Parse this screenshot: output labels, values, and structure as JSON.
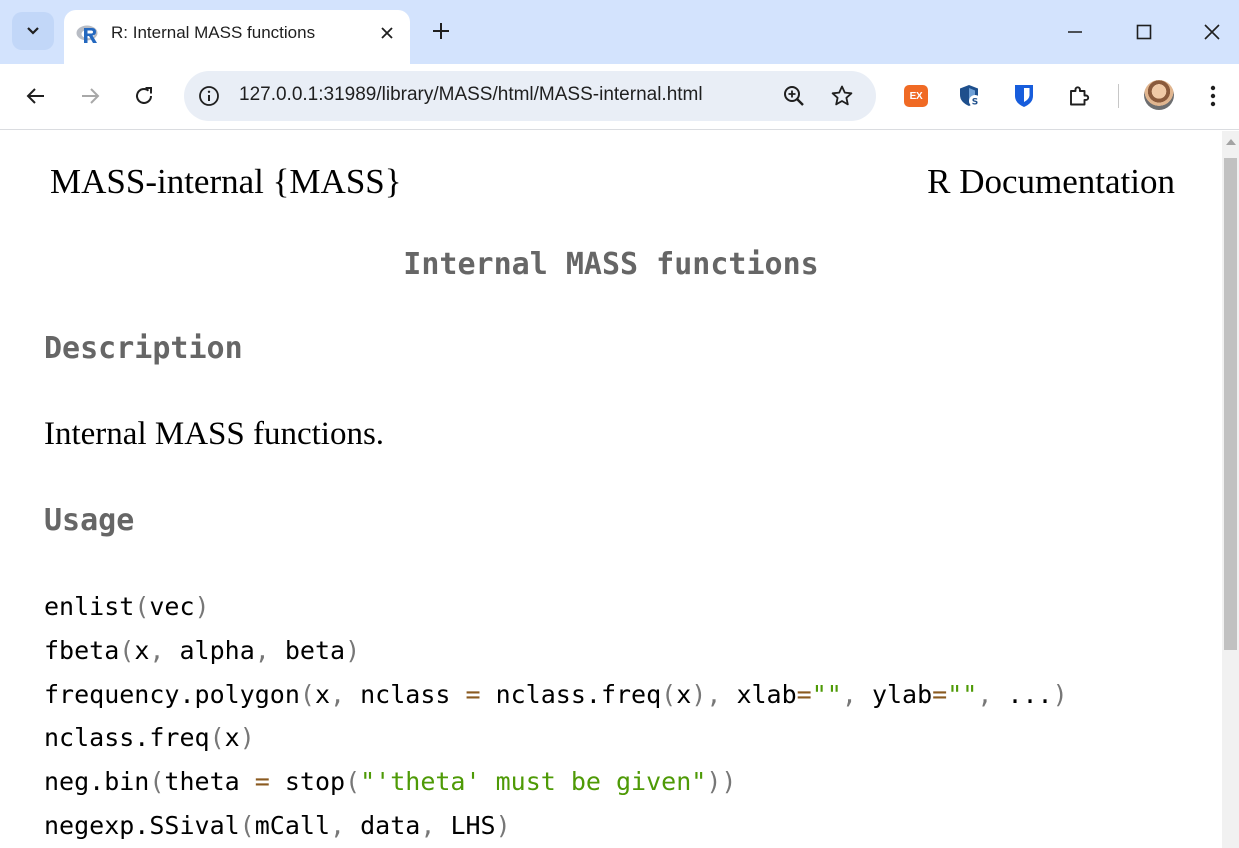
{
  "browser": {
    "tab": {
      "title": "R: Internal MASS functions",
      "favicon": "r-logo-icon"
    },
    "address_bar": {
      "url": "127.0.0.1:31989/library/MASS/html/MASS-internal.html"
    },
    "icons": {
      "tab_list": "chevron-down-icon",
      "tab_close": "close-icon",
      "new_tab": "plus-icon",
      "minimize": "minimize-icon",
      "maximize": "maximize-icon",
      "close_window": "close-icon",
      "back": "arrow-left-icon",
      "forward": "arrow-right-icon",
      "reload": "reload-icon",
      "site_info": "info-icon",
      "zoom": "zoom-in-icon",
      "bookmark": "star-icon",
      "extensions": "puzzle-icon",
      "menu": "kebab-menu-icon"
    },
    "extensions": [
      {
        "name": "ex-extension-icon",
        "label": "EX",
        "color": "#f06a24"
      },
      {
        "name": "shield-s-extension-icon",
        "color": "#1e4f8c"
      },
      {
        "name": "password-manager-shield-icon",
        "color": "#175ddc"
      }
    ]
  },
  "doc": {
    "header_left": "MASS-internal {MASS}",
    "header_right": "R Documentation",
    "title": "Internal MASS functions",
    "sections": {
      "description_heading": "Description",
      "description_text": "Internal MASS functions.",
      "usage_heading": "Usage"
    },
    "usage_lines": [
      [
        {
          "t": "enlist",
          "c": "n"
        },
        {
          "t": "(",
          "c": "p"
        },
        {
          "t": "vec",
          "c": "n"
        },
        {
          "t": ")",
          "c": "p"
        }
      ],
      [
        {
          "t": "fbeta",
          "c": "n"
        },
        {
          "t": "(",
          "c": "p"
        },
        {
          "t": "x",
          "c": "n"
        },
        {
          "t": ", ",
          "c": "p"
        },
        {
          "t": "alpha",
          "c": "n"
        },
        {
          "t": ", ",
          "c": "p"
        },
        {
          "t": "beta",
          "c": "n"
        },
        {
          "t": ")",
          "c": "p"
        }
      ],
      [
        {
          "t": "frequency.polygon",
          "c": "n"
        },
        {
          "t": "(",
          "c": "p"
        },
        {
          "t": "x",
          "c": "n"
        },
        {
          "t": ", ",
          "c": "p"
        },
        {
          "t": "nclass ",
          "c": "n"
        },
        {
          "t": "=",
          "c": "o"
        },
        {
          "t": " nclass.freq",
          "c": "n"
        },
        {
          "t": "(",
          "c": "p"
        },
        {
          "t": "x",
          "c": "n"
        },
        {
          "t": "), ",
          "c": "p"
        },
        {
          "t": "xlab",
          "c": "n"
        },
        {
          "t": "=",
          "c": "o"
        },
        {
          "t": "\"\"",
          "c": "s"
        },
        {
          "t": ", ",
          "c": "p"
        },
        {
          "t": "ylab",
          "c": "n"
        },
        {
          "t": "=",
          "c": "o"
        },
        {
          "t": "\"\"",
          "c": "s"
        },
        {
          "t": ", ",
          "c": "p"
        },
        {
          "t": "...",
          "c": "n"
        },
        {
          "t": ")",
          "c": "p"
        }
      ],
      [
        {
          "t": "nclass.freq",
          "c": "n"
        },
        {
          "t": "(",
          "c": "p"
        },
        {
          "t": "x",
          "c": "n"
        },
        {
          "t": ")",
          "c": "p"
        }
      ],
      [
        {
          "t": "neg.bin",
          "c": "n"
        },
        {
          "t": "(",
          "c": "p"
        },
        {
          "t": "theta ",
          "c": "n"
        },
        {
          "t": "=",
          "c": "o"
        },
        {
          "t": " stop",
          "c": "n"
        },
        {
          "t": "(",
          "c": "p"
        },
        {
          "t": "\"'theta' must be given\"",
          "c": "s"
        },
        {
          "t": "))",
          "c": "p"
        }
      ],
      [
        {
          "t": "negexp.SSival",
          "c": "n"
        },
        {
          "t": "(",
          "c": "p"
        },
        {
          "t": "mCall",
          "c": "n"
        },
        {
          "t": ", ",
          "c": "p"
        },
        {
          "t": "data",
          "c": "n"
        },
        {
          "t": ", ",
          "c": "p"
        },
        {
          "t": "LHS",
          "c": "n"
        },
        {
          "t": ")",
          "c": "p"
        }
      ]
    ]
  }
}
